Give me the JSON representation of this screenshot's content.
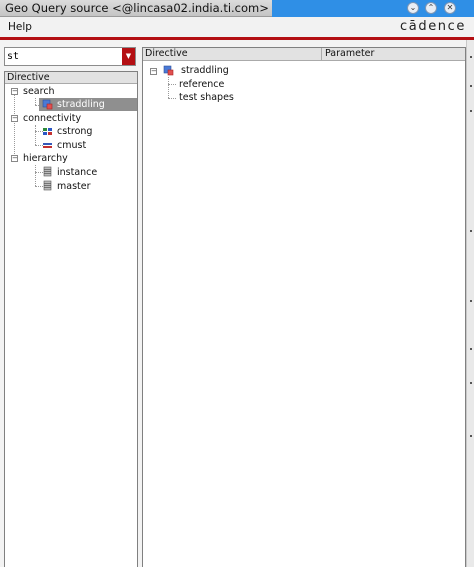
{
  "window": {
    "title": "Geo Query source <@lincasa02.india.ti.com>"
  },
  "menu": {
    "help": "Help",
    "brand": "cādence"
  },
  "search": {
    "value": "st"
  },
  "left_tree": {
    "header": "Directive",
    "groups": [
      {
        "label": "search",
        "children": [
          {
            "label": "straddling",
            "icon": "straddling-icon",
            "selected": true
          }
        ]
      },
      {
        "label": "connectivity",
        "children": [
          {
            "label": "cstrong",
            "icon": "cstrong-icon"
          },
          {
            "label": "cmust",
            "icon": "cmust-icon"
          }
        ]
      },
      {
        "label": "hierarchy",
        "children": [
          {
            "label": "instance",
            "icon": "instance-icon"
          },
          {
            "label": "master",
            "icon": "master-icon"
          }
        ]
      }
    ]
  },
  "right_tree": {
    "columns": [
      "Directive",
      "Parameter"
    ],
    "root": {
      "label": "straddling",
      "icon": "straddling-icon",
      "children": [
        "reference",
        "test shapes"
      ]
    }
  },
  "colors": {
    "accent": "#b40f13",
    "titlebar_blue": "#2f8fe6",
    "selection": "#8f8f8f"
  }
}
